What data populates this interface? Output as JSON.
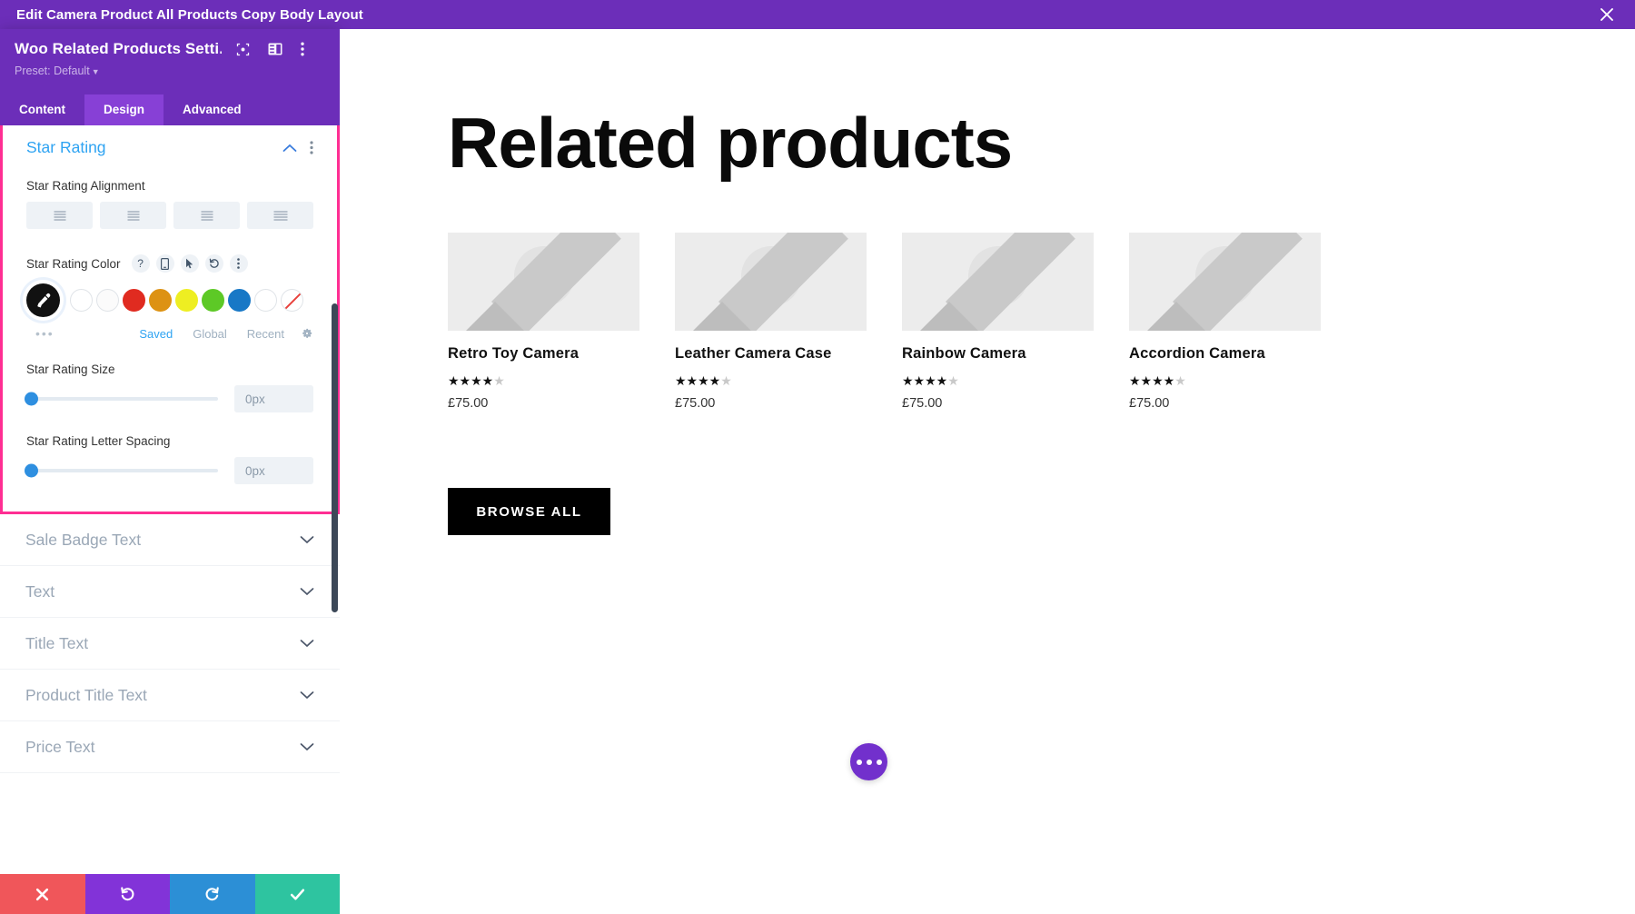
{
  "titlebar": {
    "title": "Edit Camera Product All Products Copy Body Layout",
    "close_icon": "close-icon"
  },
  "panel": {
    "module_title": "Woo Related Products Setti...",
    "preset_label": "Preset: Default",
    "header_icons": [
      "focus-target-icon",
      "layout-split-icon",
      "kebab-menu-icon"
    ],
    "tabs": [
      {
        "label": "Content",
        "active": false
      },
      {
        "label": "Design",
        "active": true
      },
      {
        "label": "Advanced",
        "active": false
      }
    ],
    "open_section": {
      "title": "Star Rating",
      "collapse_icon": "chevron-up-icon",
      "options_icon": "kebab-menu-icon",
      "alignment": {
        "label": "Star Rating Alignment",
        "options": [
          "align-left-icon",
          "align-center-icon",
          "align-right-icon",
          "align-justify-icon"
        ],
        "selected_index": -1
      },
      "color": {
        "label": "Star Rating Color",
        "tool_icons": [
          "help-icon",
          "responsive-mobile-icon",
          "hover-cursor-icon",
          "reset-undo-icon",
          "kebab-menu-icon"
        ],
        "selected_swatch_icon": "eyedropper-icon",
        "swatches": [
          {
            "name": "white",
            "hex": "#ffffff"
          },
          {
            "name": "off-white",
            "hex": "#fbfbfb"
          },
          {
            "name": "red",
            "hex": "#e02b20"
          },
          {
            "name": "orange",
            "hex": "#dd9213"
          },
          {
            "name": "yellow",
            "hex": "#eeee22"
          },
          {
            "name": "green",
            "hex": "#5dc926"
          },
          {
            "name": "blue",
            "hex": "#1878c6"
          },
          {
            "name": "white-2",
            "hex": "#ffffff"
          },
          {
            "name": "transparent",
            "hex": "#ffffff"
          }
        ],
        "more_dots": "•••",
        "palette_tabs": [
          {
            "label": "Saved",
            "active": true
          },
          {
            "label": "Global",
            "active": false
          },
          {
            "label": "Recent",
            "active": false
          }
        ],
        "settings_icon": "gear-icon"
      },
      "size": {
        "label": "Star Rating Size",
        "value": "0px",
        "slider_percent": 0
      },
      "letter_spacing": {
        "label": "Star Rating Letter Spacing",
        "value": "0px",
        "slider_percent": 0
      }
    },
    "collapsed_sections": [
      {
        "title": "Sale Badge Text",
        "chevron": "chevron-down-icon"
      },
      {
        "title": "Text",
        "chevron": "chevron-down-icon"
      },
      {
        "title": "Title Text",
        "chevron": "chevron-down-icon"
      },
      {
        "title": "Product Title Text",
        "chevron": "chevron-down-icon"
      },
      {
        "title": "Price Text",
        "chevron": "chevron-down-icon"
      }
    ],
    "actions": [
      {
        "name": "cancel",
        "icon": "x-icon",
        "color": "#f0565a"
      },
      {
        "name": "undo",
        "icon": "undo-arrow-icon",
        "color": "#8233d8"
      },
      {
        "name": "redo",
        "icon": "redo-arrow-icon",
        "color": "#2c8fd6"
      },
      {
        "name": "save",
        "icon": "check-icon",
        "color": "#2ec4a0"
      }
    ]
  },
  "preview": {
    "heading": "Related products",
    "products": [
      {
        "title": "Retro Toy Camera",
        "rating_filled": 4,
        "rating_total": 5,
        "price": "£75.00"
      },
      {
        "title": "Leather Camera Case",
        "rating_filled": 4,
        "rating_total": 5,
        "price": "£75.00"
      },
      {
        "title": "Rainbow Camera",
        "rating_filled": 4,
        "rating_total": 5,
        "price": "£75.00"
      },
      {
        "title": "Accordion Camera",
        "rating_filled": 4,
        "rating_total": 5,
        "price": "£75.00"
      }
    ],
    "browse_button": "BROWSE ALL",
    "fab_icon": "more-options-icon"
  },
  "colors": {
    "brand_purple": "#6c2eb9",
    "tab_active": "#8740d6",
    "highlight_pink": "#ff2e93",
    "link_blue": "#2ea3f2"
  }
}
